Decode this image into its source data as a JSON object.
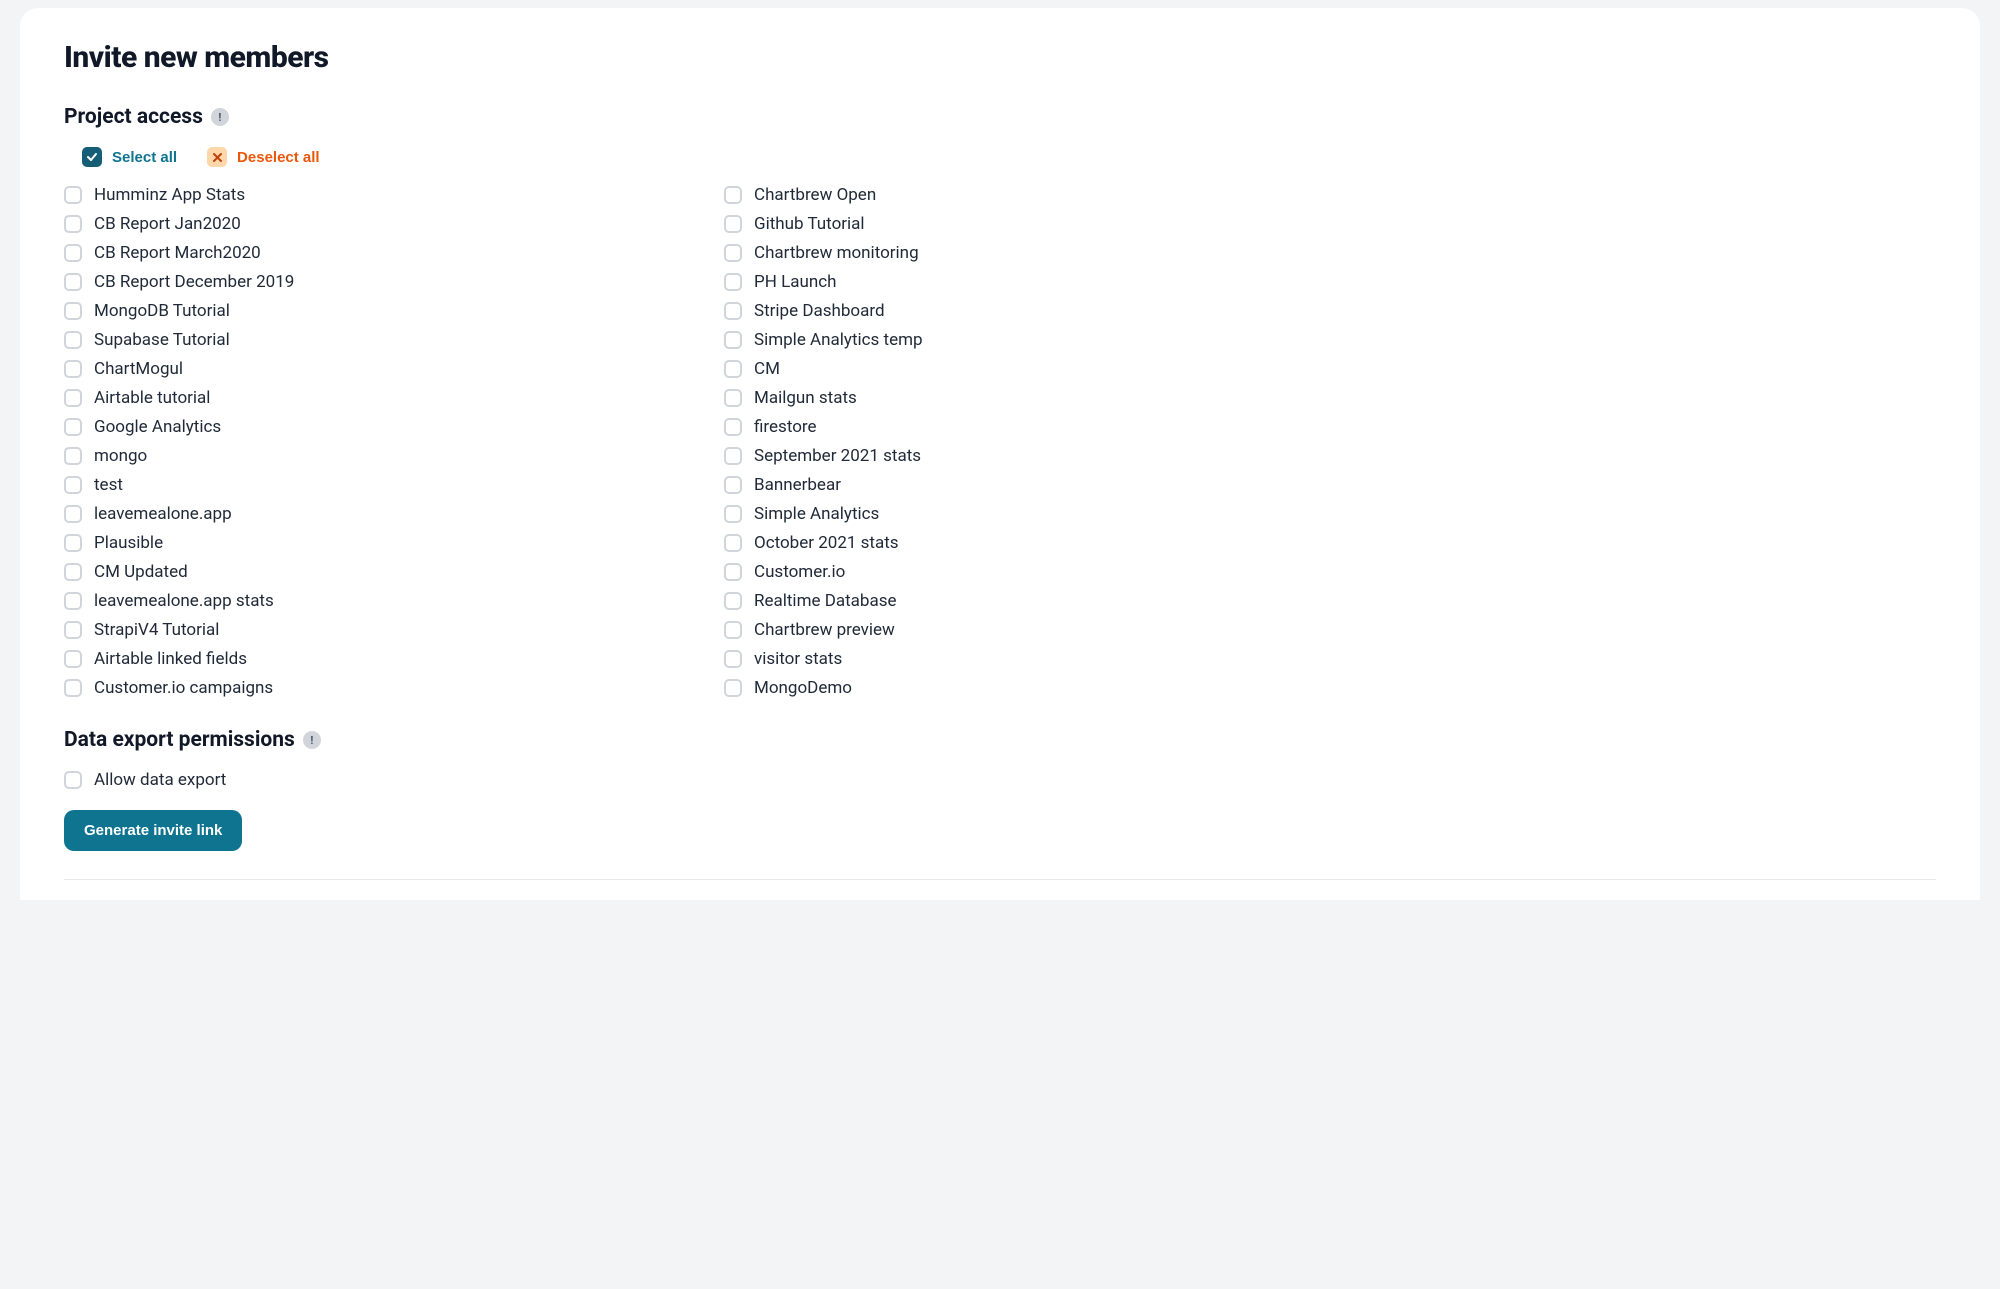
{
  "page_title": "Invite new members",
  "sections": {
    "project_access": {
      "heading": "Project access",
      "select_all_label": "Select all",
      "deselect_all_label": "Deselect all"
    },
    "data_export": {
      "heading": "Data export permissions",
      "allow_label": "Allow data export"
    }
  },
  "projects_col1": [
    "Humminz App Stats",
    "CB Report Jan2020",
    "CB Report March2020",
    "CB Report December 2019",
    "MongoDB Tutorial",
    "Supabase Tutorial",
    "ChartMogul",
    "Airtable tutorial",
    "Google Analytics",
    "mongo",
    "test",
    "leavemealone.app",
    "Plausible",
    "CM Updated",
    "leavemealone.app stats",
    "StrapiV4 Tutorial",
    "Airtable linked fields",
    "Customer.io campaigns"
  ],
  "projects_col2": [
    "Chartbrew Open",
    "Github Tutorial",
    "Chartbrew monitoring",
    "PH Launch",
    "Stripe Dashboard",
    "Simple Analytics temp",
    "CM",
    "Mailgun stats",
    "firestore",
    "September 2021 stats",
    "Bannerbear",
    "Simple Analytics",
    "October 2021 stats",
    "Customer.io",
    "Realtime Database",
    "Chartbrew preview",
    "visitor stats",
    "MongoDemo"
  ],
  "generate_button_label": "Generate invite link"
}
